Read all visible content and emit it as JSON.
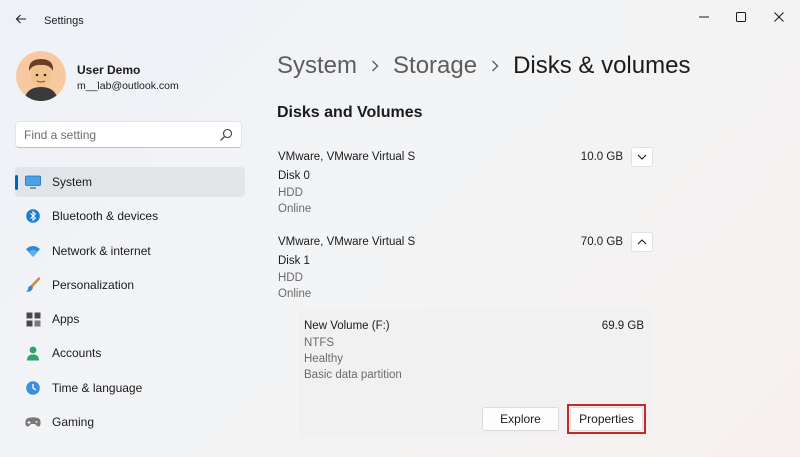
{
  "window": {
    "app_title": "Settings",
    "controls": {
      "minimize": "minimize-icon",
      "maximize": "maximize-icon",
      "close": "close-icon"
    }
  },
  "user": {
    "name": "User Demo",
    "email": "m__lab@outlook.com"
  },
  "search": {
    "placeholder": "Find a setting",
    "value": ""
  },
  "nav": {
    "items": [
      {
        "label": "System",
        "icon": "display-icon",
        "active": true
      },
      {
        "label": "Bluetooth & devices",
        "icon": "bluetooth-icon",
        "active": false
      },
      {
        "label": "Network & internet",
        "icon": "wifi-icon",
        "active": false
      },
      {
        "label": "Personalization",
        "icon": "brush-icon",
        "active": false
      },
      {
        "label": "Apps",
        "icon": "apps-icon",
        "active": false
      },
      {
        "label": "Accounts",
        "icon": "person-icon",
        "active": false
      },
      {
        "label": "Time & language",
        "icon": "clock-globe-icon",
        "active": false
      },
      {
        "label": "Gaming",
        "icon": "gamepad-icon",
        "active": false
      }
    ]
  },
  "breadcrumb": {
    "items": [
      "System",
      "Storage"
    ],
    "current": "Disks & volumes"
  },
  "section_title": "Disks and Volumes",
  "disks": [
    {
      "model": "VMware, VMware Virtual S",
      "size": "10.0 GB",
      "name": "Disk 0",
      "type": "HDD",
      "status": "Online",
      "expanded": false
    },
    {
      "model": "VMware, VMware Virtual S",
      "size": "70.0 GB",
      "name": "Disk 1",
      "type": "HDD",
      "status": "Online",
      "expanded": true
    }
  ],
  "volume": {
    "name": "New Volume (F:)",
    "size": "69.9 GB",
    "filesystem": "NTFS",
    "health": "Healthy",
    "partition": "Basic data partition",
    "explore_label": "Explore",
    "properties_label": "Properties"
  },
  "colors": {
    "accent": "#0067c0",
    "highlight": "#c62828"
  }
}
